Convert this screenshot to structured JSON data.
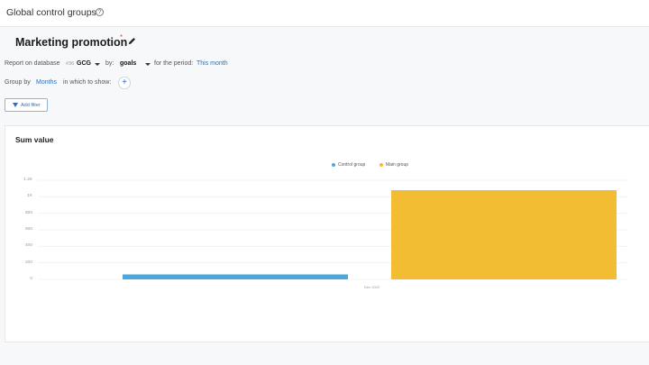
{
  "header": {
    "title": "Global control groups",
    "help_icon": "question-circle-icon"
  },
  "report": {
    "name": "Marketing promotion",
    "unsaved_marker": "*",
    "edit_icon": "pencil-icon"
  },
  "filters_row": {
    "database_label": "Report on database",
    "database_prefix": "#36",
    "database_value": "GCG",
    "by_label": "by:",
    "by_value": "goals",
    "period_label": "for the period:",
    "period_value": "This month"
  },
  "group_row": {
    "group_by_label": "Group by",
    "group_by_value": "Months",
    "show_label": "in which to show:",
    "add_label": "+"
  },
  "add_filter": {
    "label": "Add filter",
    "icon": "funnel-icon"
  },
  "chart_card": {
    "title": "Sum value"
  },
  "colors": {
    "control_group": "#4aa8de",
    "main_group": "#f2bd33",
    "link": "#2f6fb6"
  },
  "chart_data": {
    "type": "bar",
    "title": "Sum value",
    "categories": [
      "Dec 2022"
    ],
    "series": [
      {
        "name": "Control group",
        "values": [
          60
        ]
      },
      {
        "name": "Main group",
        "values": [
          1080
        ]
      }
    ],
    "yticks": [
      "0",
      "200",
      "400",
      "600",
      "800",
      "1K",
      "1.2K"
    ],
    "ylim": [
      0,
      1200
    ],
    "grid": true,
    "legend_position": "top-center"
  }
}
